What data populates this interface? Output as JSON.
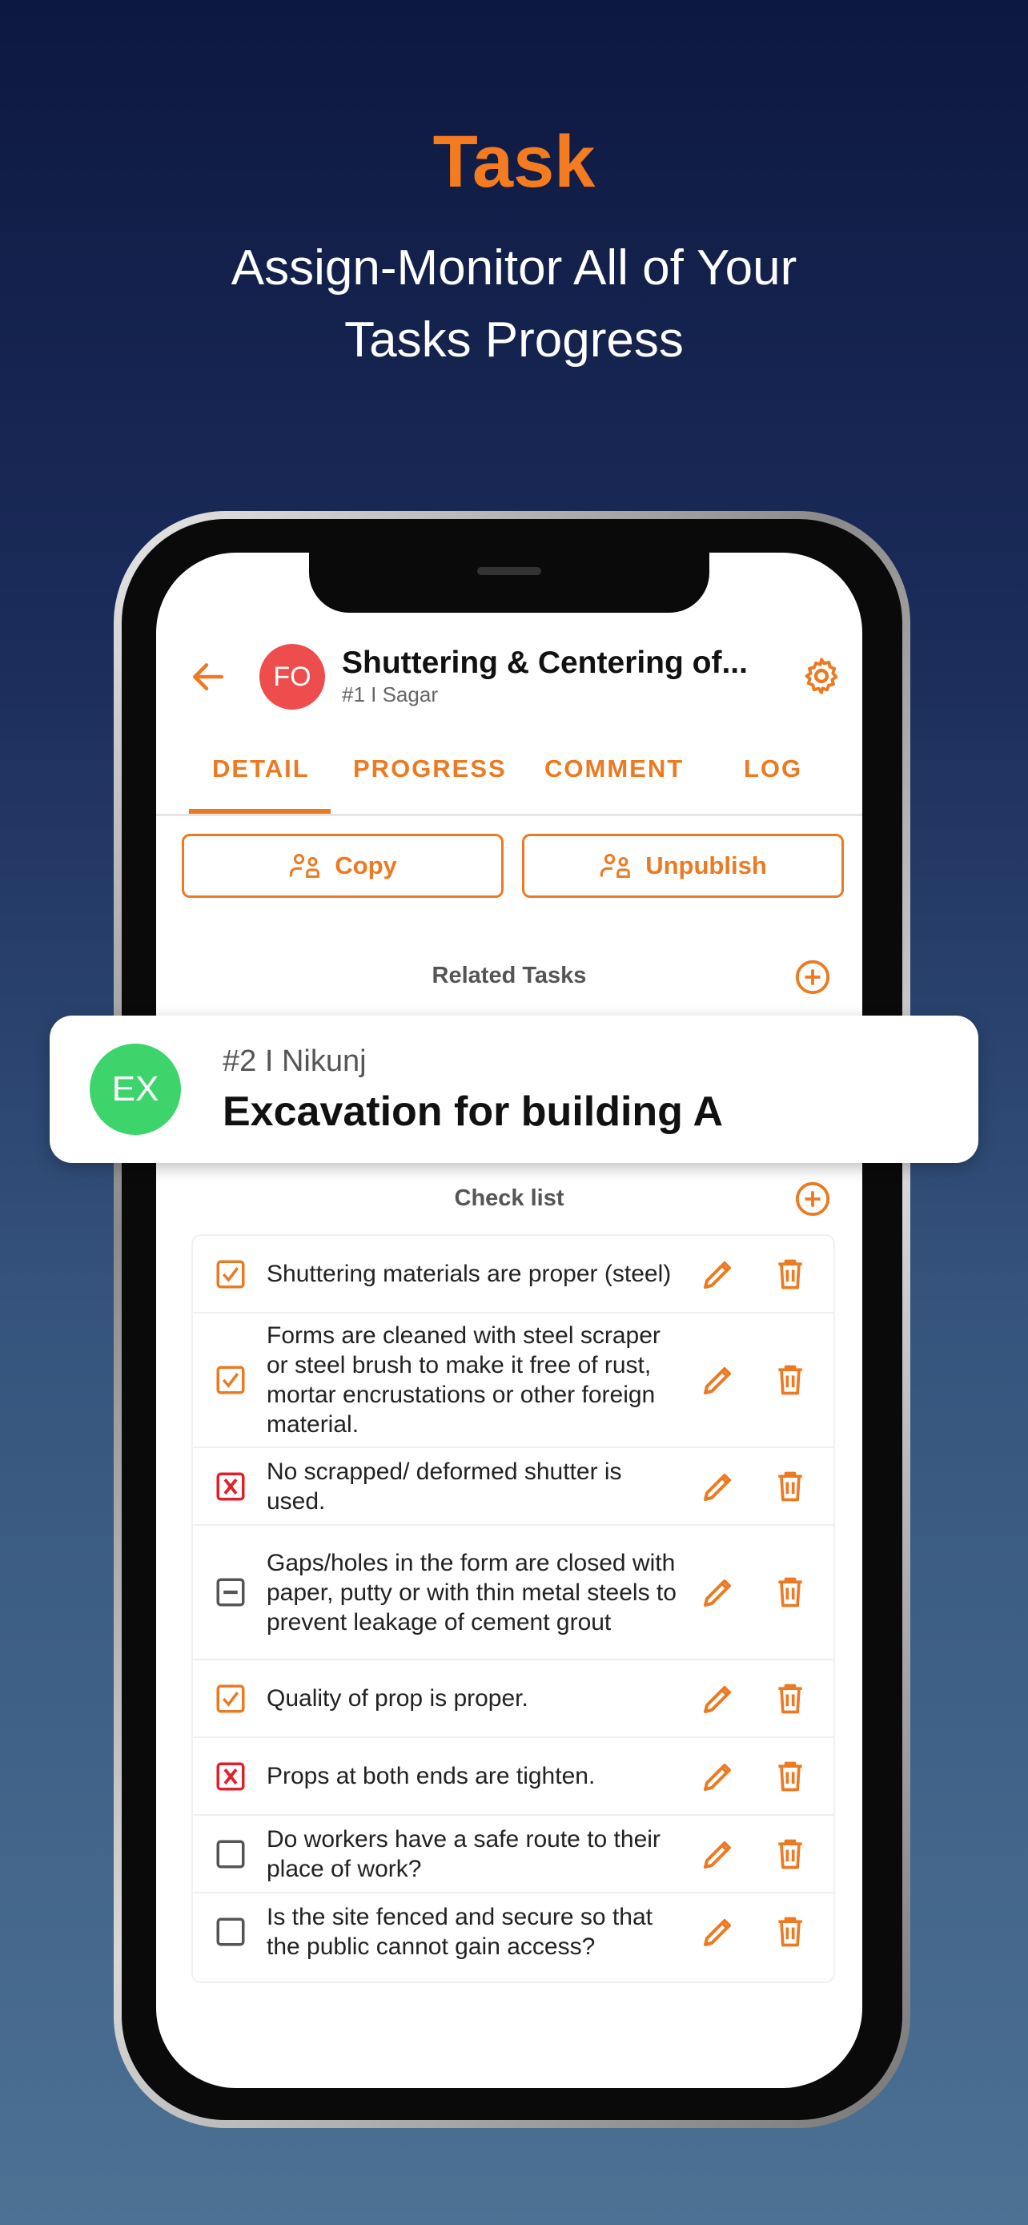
{
  "hero": {
    "title": "Task",
    "subtitle_line1": "Assign-Monitor All of Your",
    "subtitle_line2": "Tasks Progress"
  },
  "colors": {
    "accent": "#ec7a22",
    "avatar_fo": "#ee4d4d",
    "avatar_ex": "#3dd56b",
    "fail": "#e0212a"
  },
  "header": {
    "avatar": "FO",
    "title": "Shuttering & Centering of...",
    "subtitle": "#1 I Sagar"
  },
  "tabs": [
    {
      "label": "DETAIL",
      "active": true
    },
    {
      "label": "PROGRESS"
    },
    {
      "label": "COMMENT"
    },
    {
      "label": "LOG"
    }
  ],
  "actions": {
    "copy": "Copy",
    "unpublish": "Unpublish"
  },
  "related": {
    "label": "Related Tasks",
    "task": {
      "avatar": "EX",
      "sub": "#2 I Nikunj",
      "title": "Excavation for building A"
    }
  },
  "checklist": {
    "label": "Check list",
    "items": [
      {
        "text": "Shuttering materials are proper (steel)",
        "status": "checked"
      },
      {
        "text": "Forms are cleaned with steel scraper or steel brush to make it free of rust, mortar encrustations or other foreign material.",
        "status": "checked"
      },
      {
        "text": "No scrapped/ deformed shutter is used.",
        "status": "failed"
      },
      {
        "text": "Gaps/holes in the form are closed with paper, putty or with thin metal steels to prevent leakage of cement grout",
        "status": "na"
      },
      {
        "text": "Quality of prop is proper.",
        "status": "checked"
      },
      {
        "text": "Props at both ends are tighten.",
        "status": "failed"
      },
      {
        "text": "Do workers have a safe route to their place of work?",
        "status": "unchecked"
      },
      {
        "text": "Is the site fenced and secure so that the public cannot gain access?",
        "status": "unchecked"
      }
    ]
  }
}
